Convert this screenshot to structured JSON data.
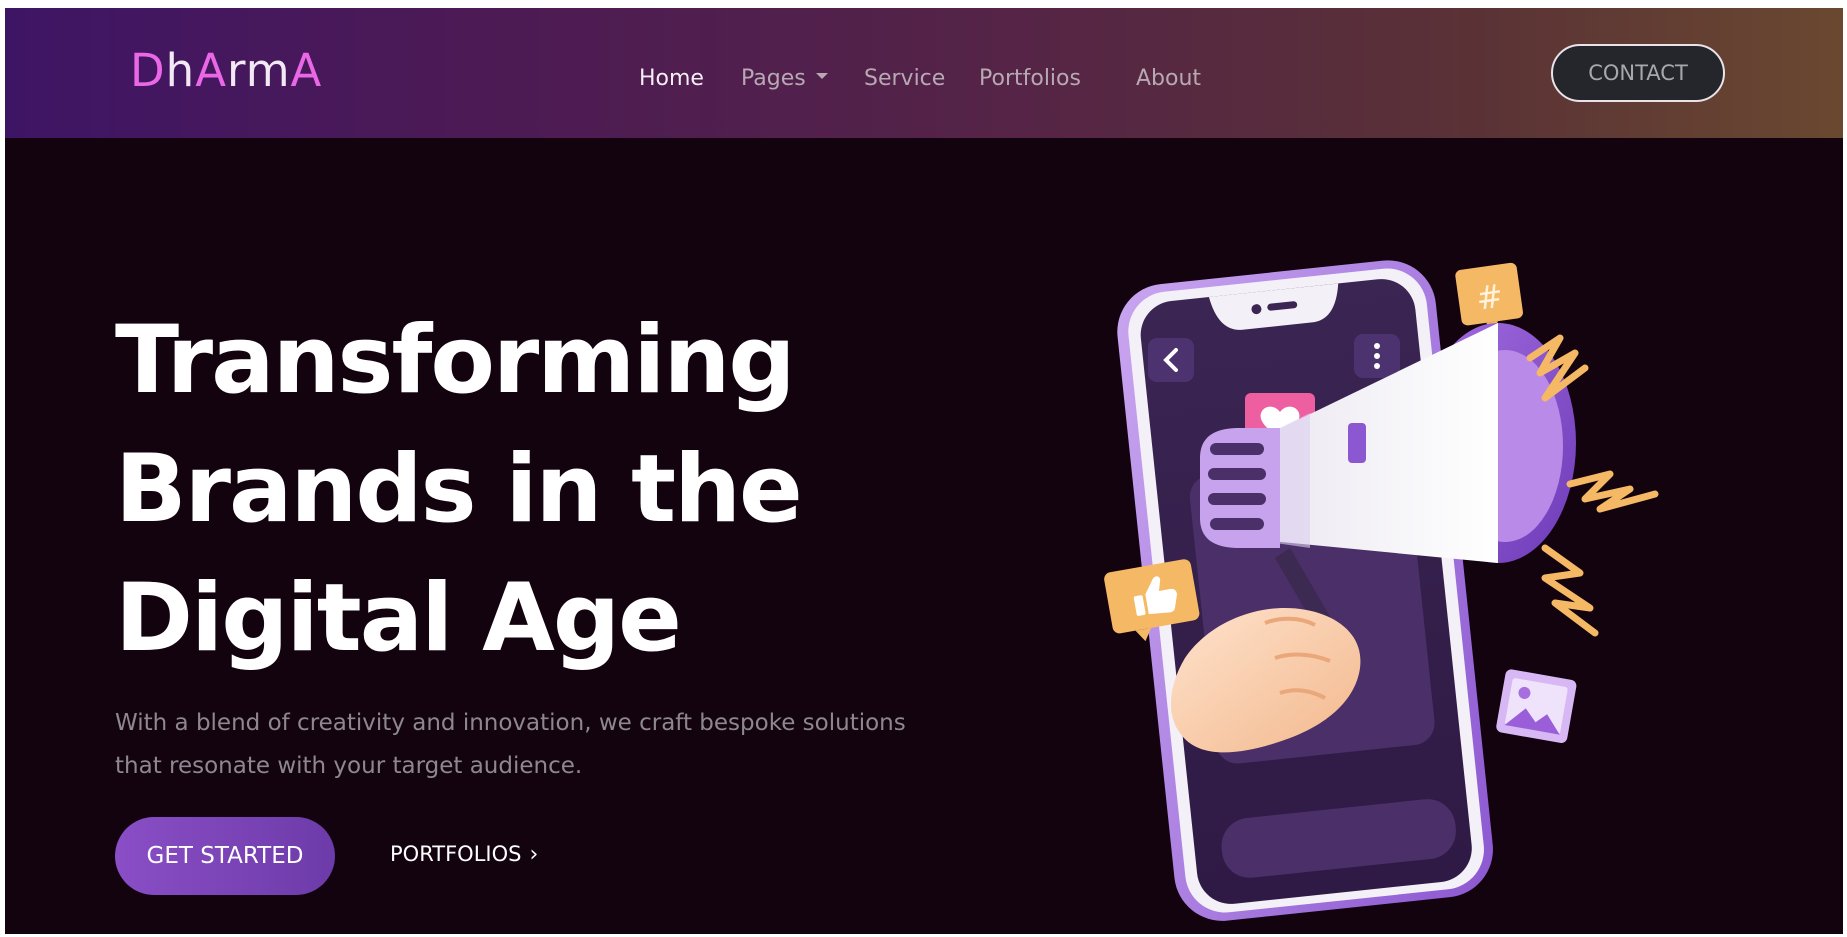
{
  "logo": {
    "letters": [
      "D",
      "h",
      "A",
      "rm",
      "A"
    ]
  },
  "nav": {
    "items": [
      {
        "label": "Home",
        "active": true
      },
      {
        "label": "Pages",
        "has_dropdown": true
      },
      {
        "label": "Service"
      },
      {
        "label": "Portfolios"
      },
      {
        "label": "About"
      }
    ],
    "contact_label": "CONTACT"
  },
  "hero": {
    "title_lines": [
      "Transforming",
      "Brands in the",
      "Digital Age"
    ],
    "subtitle_lines": [
      "With a blend of creativity and innovation, we craft bespoke solutions",
      "that resonate with your target audience."
    ],
    "primary_button": "GET STARTED",
    "secondary_button": "PORTFOLIOS"
  },
  "illustration": {
    "subject": "phone with megaphone",
    "icons": [
      "hashtag-icon",
      "heart-icon",
      "thumbs-up-icon",
      "image-icon",
      "back-arrow-icon",
      "more-vertical-icon"
    ],
    "hashtag_symbol": "#"
  },
  "colors": {
    "accent_pink": "#ea67e6",
    "button_purple": "#8a4ec6",
    "page_background": "#12030f",
    "nav_gradient_start": "#3e1565",
    "nav_gradient_end": "#6a4830"
  }
}
